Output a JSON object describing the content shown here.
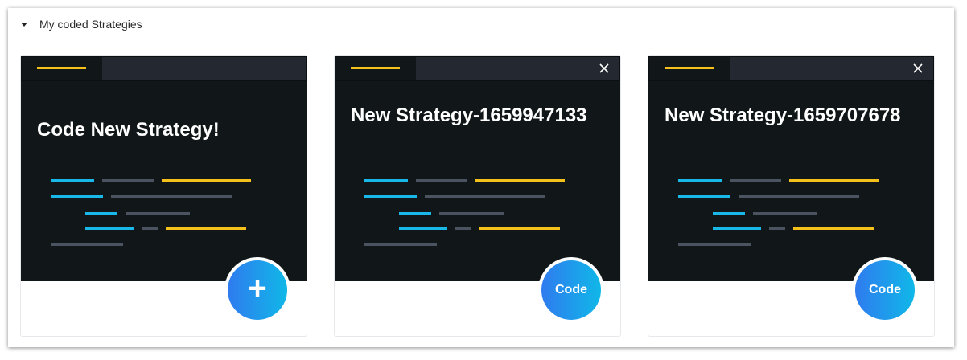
{
  "section": {
    "title": "My coded Strategies",
    "expanded": true
  },
  "cards": [
    {
      "title": "Code New Strategy!",
      "action_label": "+",
      "closable": false
    },
    {
      "title": "New Strategy-1659947133",
      "action_label": "Code",
      "closable": true
    },
    {
      "title": "New Strategy-1659707678",
      "action_label": "Code",
      "closable": true
    }
  ],
  "colors": {
    "card_background": "#111719",
    "tab_accent": "#f5c01c",
    "code_cyan": "#1ab8e8",
    "code_gray": "#4b5360",
    "button_gradient_start": "#2f7bef",
    "button_gradient_end": "#10b8e8"
  },
  "icons": {
    "collapse": "caret-down-icon",
    "close": "close-icon",
    "create": "plus-icon"
  }
}
